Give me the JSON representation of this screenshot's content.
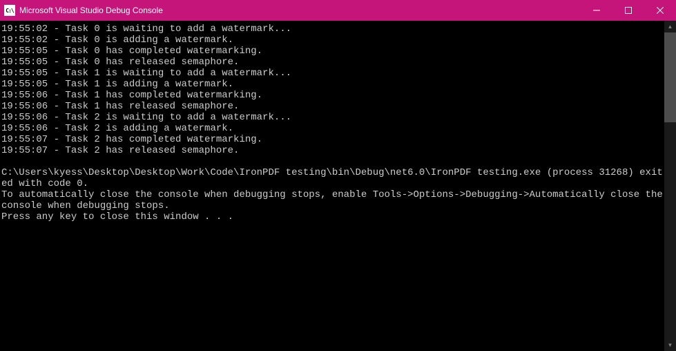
{
  "titlebar": {
    "icon_text": "C:\\",
    "title": "Microsoft Visual Studio Debug Console"
  },
  "console": {
    "log_lines": [
      "19:55:02 - Task 0 is waiting to add a watermark...",
      "19:55:02 - Task 0 is adding a watermark.",
      "19:55:05 - Task 0 has completed watermarking.",
      "19:55:05 - Task 0 has released semaphore.",
      "19:55:05 - Task 1 is waiting to add a watermark...",
      "19:55:05 - Task 1 is adding a watermark.",
      "19:55:06 - Task 1 has completed watermarking.",
      "19:55:06 - Task 1 has released semaphore.",
      "19:55:06 - Task 2 is waiting to add a watermark...",
      "19:55:06 - Task 2 is adding a watermark.",
      "19:55:07 - Task 2 has completed watermarking.",
      "19:55:07 - Task 2 has released semaphore."
    ],
    "exit_message": "C:\\Users\\kyess\\Desktop\\Desktop\\Work\\Code\\IronPDF testing\\bin\\Debug\\net6.0\\IronPDF testing.exe (process 31268) exited with code 0.",
    "auto_close_message": "To automatically close the console when debugging stops, enable Tools->Options->Debugging->Automatically close the console when debugging stops.",
    "press_key_message": "Press any key to close this window . . ."
  }
}
